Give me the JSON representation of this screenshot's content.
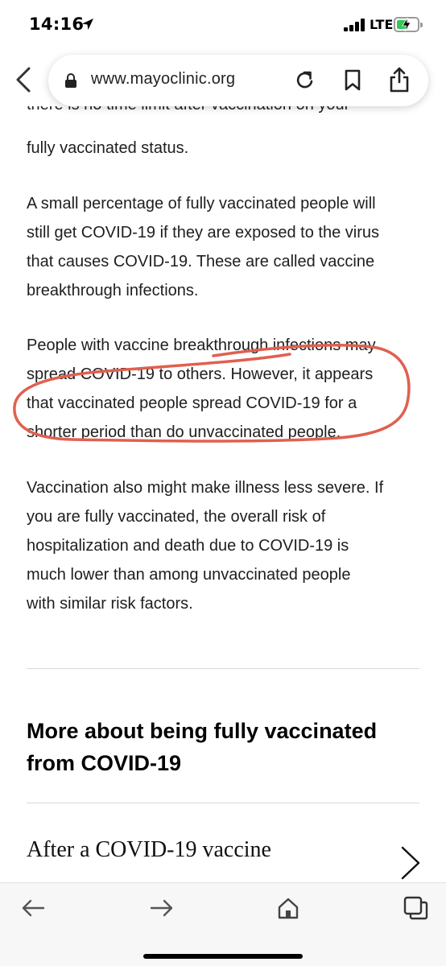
{
  "status_bar": {
    "time": "14:16",
    "network": "LTE",
    "battery_level": 0.6,
    "battery_color": "#34c759"
  },
  "browser": {
    "url": "www.mayoclinic.org",
    "icons": [
      "back-chevron-icon",
      "lock-icon",
      "reload-icon",
      "bookmark-icon",
      "share-icon"
    ]
  },
  "article": {
    "clipped_line": "there is no time limit after vaccination on your",
    "paragraphs": [
      {
        "lines": [
          "fully vaccinated status."
        ]
      },
      {
        "lines": [
          "A small percentage of fully vaccinated people will",
          "still get COVID-19 if they are exposed to the virus",
          "that causes COVID-19. These are called vaccine",
          "breakthrough infections."
        ]
      },
      {
        "lines": [
          "People with vaccine breakthrough infections may",
          "spread COVID-19 to others. However, it appears",
          "that vaccinated people spread COVID-19 for a",
          "shorter period than do unvaccinated people."
        ]
      },
      {
        "lines": [
          "Vaccination also might make illness less severe. If",
          "you are fully vaccinated, the overall risk of",
          "hospitalization and death due to COVID-19 is",
          "much lower than among unvaccinated people",
          "with similar risk factors."
        ]
      }
    ],
    "highlight_color": "#e0604f"
  },
  "related": {
    "heading": "More about being fully vaccinated from COVID-19",
    "link_label": "After a COVID-19 vaccine"
  },
  "toolbar": {
    "icons": [
      "back-arrow-icon",
      "forward-arrow-icon",
      "home-icon",
      "tabs-icon"
    ]
  }
}
